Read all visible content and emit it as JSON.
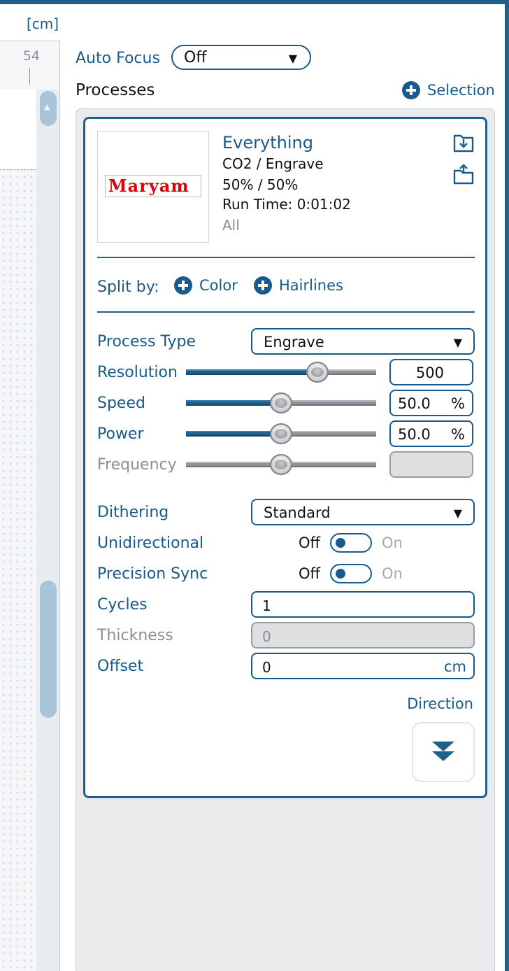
{
  "ruler": {
    "unit": "[cm]",
    "mark": "54"
  },
  "auto_focus": {
    "label": "Auto Focus",
    "value": "Off"
  },
  "processes": {
    "title": "Processes",
    "selection_label": "Selection"
  },
  "process": {
    "name": "Everything",
    "laser_mode": "CO2 / Engrave",
    "power_speed": "50%  /  50%",
    "run_time": "Run Time: 0:01:02",
    "scope": "All",
    "logo_text": "Maryam"
  },
  "split": {
    "label": "Split by:",
    "color": "Color",
    "hairlines": "Hairlines"
  },
  "settings": {
    "process_type": {
      "label": "Process Type",
      "value": "Engrave"
    },
    "resolution": {
      "label": "Resolution",
      "value": "500",
      "slider_fraction": 0.69
    },
    "speed": {
      "label": "Speed",
      "value": "50.0",
      "unit": "%",
      "slider_fraction": 0.5
    },
    "power": {
      "label": "Power",
      "value": "50.0",
      "unit": "%",
      "slider_fraction": 0.5
    },
    "frequency": {
      "label": "Frequency",
      "value": "",
      "slider_fraction": 0.5
    },
    "dithering": {
      "label": "Dithering",
      "value": "Standard"
    },
    "unidirectional": {
      "label": "Unidirectional",
      "off": "Off",
      "on": "On"
    },
    "precision_sync": {
      "label": "Precision Sync",
      "off": "Off",
      "on": "On"
    },
    "cycles": {
      "label": "Cycles",
      "value": "1"
    },
    "thickness": {
      "label": "Thickness",
      "value": "0"
    },
    "offset": {
      "label": "Offset",
      "value": "0",
      "unit": "cm"
    },
    "direction": {
      "label": "Direction"
    }
  },
  "colors": {
    "accent": "#1a5a8a",
    "border": "#1f5f8b",
    "disabled": "#8a8f95"
  }
}
